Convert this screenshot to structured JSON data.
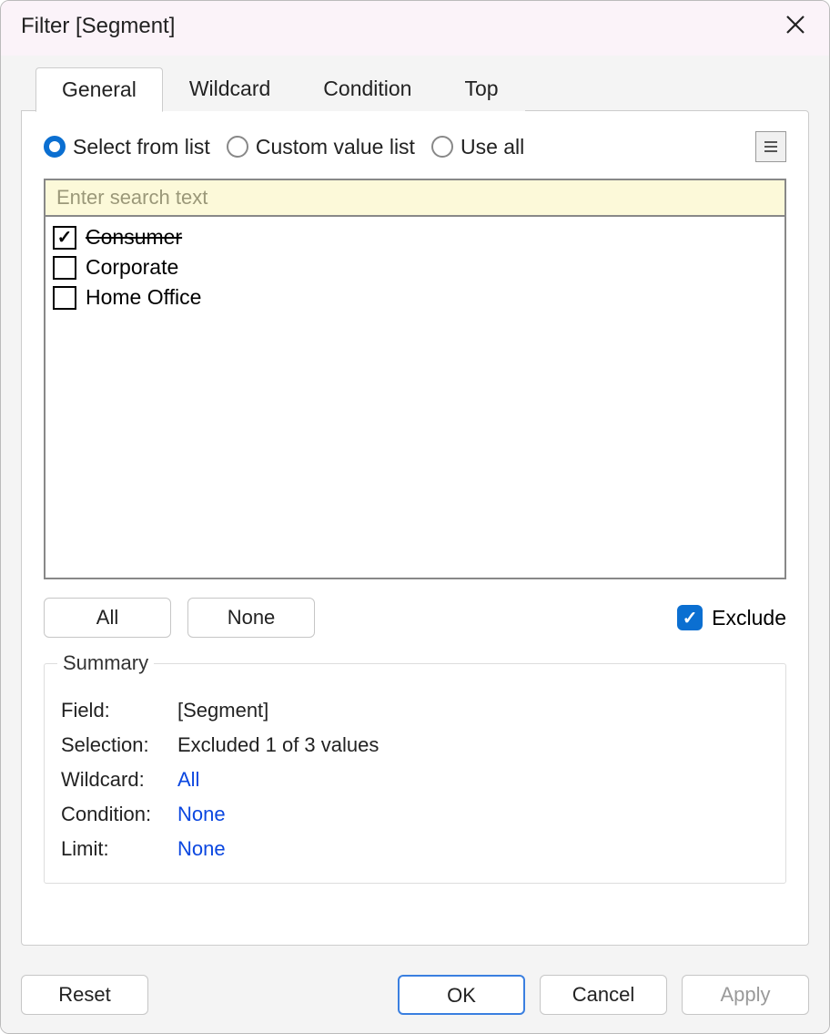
{
  "title": "Filter [Segment]",
  "tabs": [
    {
      "label": "General"
    },
    {
      "label": "Wildcard"
    },
    {
      "label": "Condition"
    },
    {
      "label": "Top"
    }
  ],
  "activeTab": 0,
  "radios": {
    "selectFromList": "Select from list",
    "customValueList": "Custom value list",
    "useAll": "Use all"
  },
  "search": {
    "placeholder": "Enter search text",
    "value": ""
  },
  "items": [
    {
      "label": "Consumer",
      "checked": true,
      "excluded": true
    },
    {
      "label": "Corporate",
      "checked": false,
      "excluded": false
    },
    {
      "label": "Home Office",
      "checked": false,
      "excluded": false
    }
  ],
  "buttons": {
    "all": "All",
    "none": "None",
    "exclude": "Exclude",
    "reset": "Reset",
    "ok": "OK",
    "cancel": "Cancel",
    "apply": "Apply"
  },
  "summary": {
    "title": "Summary",
    "fieldLabel": "Field:",
    "fieldValue": "[Segment]",
    "selectionLabel": "Selection:",
    "selectionValue": "Excluded 1 of 3 values",
    "wildcardLabel": "Wildcard:",
    "wildcardValue": "All",
    "conditionLabel": "Condition:",
    "conditionValue": "None",
    "limitLabel": "Limit:",
    "limitValue": "None"
  }
}
